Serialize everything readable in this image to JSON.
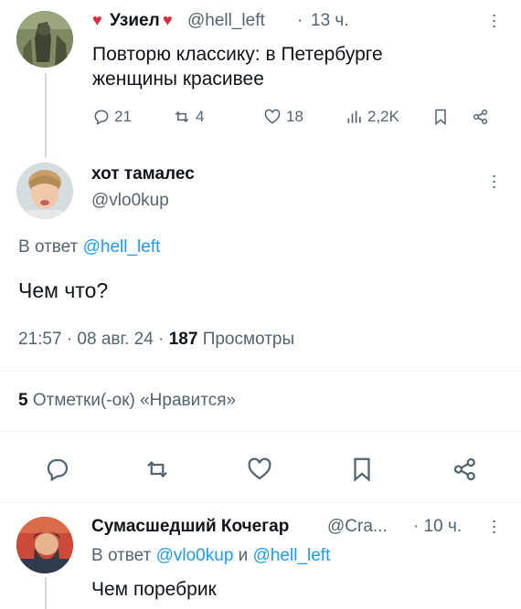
{
  "tweet1": {
    "author": "Узиел",
    "handle": "@hell_left",
    "time_sep": "·",
    "time": "13 ч.",
    "text": "Повторю классику: в Петербурге женщины красивее",
    "actions": {
      "replies": "21",
      "retweets": "4",
      "likes": "18",
      "views": "2,2K"
    }
  },
  "tweet2": {
    "author": "хот тамалес",
    "handle": "@vlo0kup",
    "reply_prefix": "В ответ",
    "reply_to": "@hell_left",
    "text": "Чем что?",
    "timestamp": "21:57 · 08 авг. 24 ·",
    "views_count": "187",
    "views_label": "Просмотры",
    "likes_count": "5",
    "likes_label": "Отметки(-ок) «Нравится»"
  },
  "tweet3": {
    "author": "Сумасшедший Кочегар",
    "handle": "@Cra...",
    "time": "· 10 ч.",
    "reply_prefix": "В ответ",
    "reply_to_1": "@vlo0kup",
    "reply_and": "и",
    "reply_to_2": "@hell_left",
    "text": "Чем поребрик"
  },
  "colors": {
    "text": "#0f1419",
    "muted": "#536471",
    "link": "#1d9bf0",
    "heart_emoji": "#e0245e"
  }
}
